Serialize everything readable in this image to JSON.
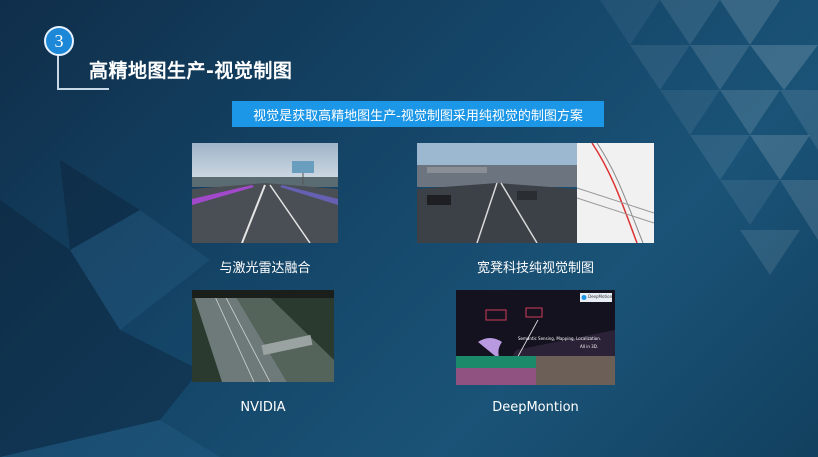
{
  "slide": {
    "number": "3",
    "title": "高精地图生产-视觉制图",
    "banner": "视觉是获取高精地图生产-视觉制图采用纯视觉的制图方案"
  },
  "panels": [
    {
      "caption": "与激光雷达融合"
    },
    {
      "caption": "宽凳科技纯视觉制图"
    },
    {
      "caption": "NVIDIA"
    },
    {
      "caption": "DeepMontion",
      "inset_brand": "DeepMotion",
      "inset_text": "Semantic Sensing, Mapping, Localization.",
      "inset_sub": "All in 3D."
    }
  ],
  "colors": {
    "accent": "#1c96e6",
    "background": "#15476a"
  }
}
